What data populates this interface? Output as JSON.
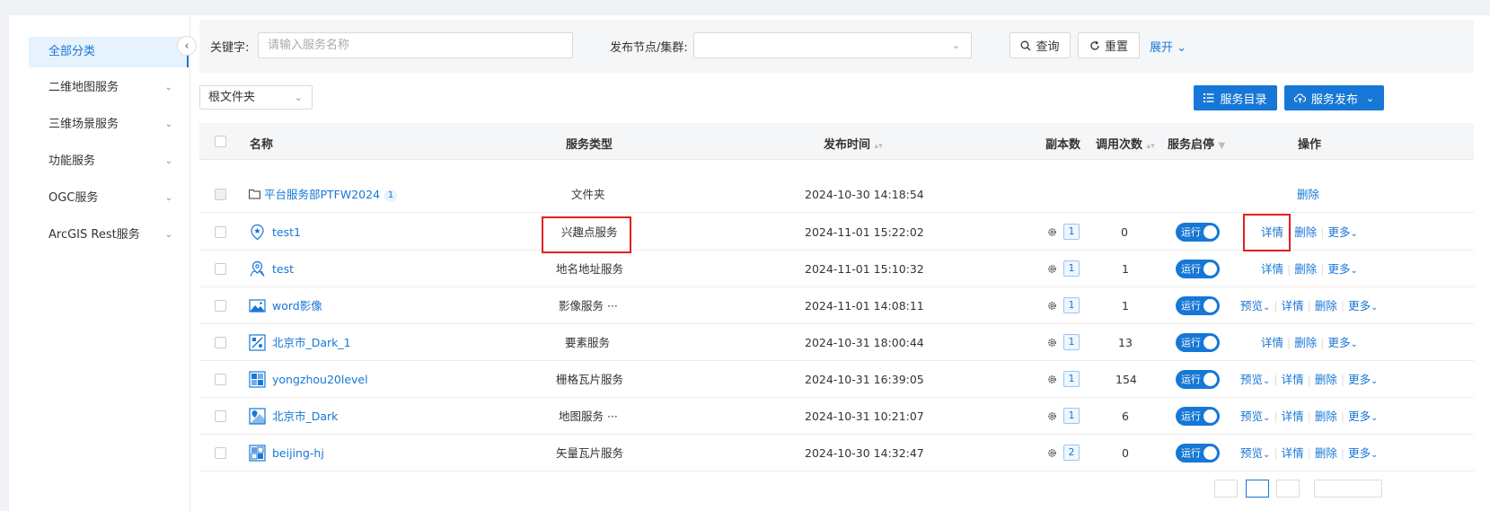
{
  "sidebar": {
    "collapse_icon": "chevron-left-icon",
    "items": [
      {
        "label": "全部分类",
        "active": true
      },
      {
        "label": "二维地图服务"
      },
      {
        "label": "三维场景服务"
      },
      {
        "label": "功能服务"
      },
      {
        "label": "OGC服务"
      },
      {
        "label": "ArcGIS Rest服务"
      }
    ]
  },
  "search": {
    "keyword_label": "关键字:",
    "keyword_placeholder": "请输入服务名称",
    "node_label": "发布节点/集群:",
    "node_value": "",
    "query_label": "查询",
    "reset_label": "重置",
    "expand_label": "展开"
  },
  "toolbar": {
    "folder_value": "根文件夹",
    "catalog_label": "服务目录",
    "publish_label": "服务发布"
  },
  "table": {
    "headers": {
      "name": "名称",
      "type": "服务类型",
      "time": "发布时间",
      "replicas": "副本数",
      "calls": "调用次数",
      "status": "服务启停",
      "ops": "操作"
    },
    "rows": [
      {
        "name": "平台服务部PTFW2024",
        "badge": "1",
        "icon": "folder-icon",
        "type": "文件夹",
        "time": "2024-10-30 14:18:54",
        "replicas": "",
        "calls": "",
        "status": "",
        "ops": [
          "删除"
        ]
      },
      {
        "name": "test1",
        "icon": "poi-pin-icon",
        "type": "兴趣点服务",
        "time": "2024-11-01 15:22:02",
        "replicas": "1",
        "calls": "0",
        "status": "运行",
        "ops": [
          "详情",
          "删除",
          "更多"
        ]
      },
      {
        "name": "test",
        "icon": "geocode-pin-icon",
        "type": "地名地址服务",
        "time": "2024-11-01 15:10:32",
        "replicas": "1",
        "calls": "1",
        "status": "运行",
        "ops": [
          "详情",
          "删除",
          "更多"
        ]
      },
      {
        "name": "word影像",
        "icon": "image-service-icon",
        "type": "影像服务 ···",
        "time": "2024-11-01 14:08:11",
        "replicas": "1",
        "calls": "1",
        "status": "运行",
        "ops": [
          "预览",
          "详情",
          "删除",
          "更多"
        ]
      },
      {
        "name": "北京市_Dark_1",
        "icon": "feature-service-icon",
        "type": "要素服务",
        "time": "2024-10-31 18:00:44",
        "replicas": "1",
        "calls": "13",
        "status": "运行",
        "ops": [
          "详情",
          "删除",
          "更多"
        ]
      },
      {
        "name": "yongzhou20level",
        "icon": "raster-tile-icon",
        "type": "栅格瓦片服务",
        "time": "2024-10-31 16:39:05",
        "replicas": "1",
        "calls": "154",
        "status": "运行",
        "ops": [
          "预览",
          "详情",
          "删除",
          "更多"
        ]
      },
      {
        "name": "北京市_Dark",
        "icon": "map-service-icon",
        "type": "地图服务 ···",
        "time": "2024-10-31 10:21:07",
        "replicas": "1",
        "calls": "6",
        "status": "运行",
        "ops": [
          "预览",
          "详情",
          "删除",
          "更多"
        ]
      },
      {
        "name": "beijing-hj",
        "icon": "vector-tile-icon",
        "type": "矢量瓦片服务",
        "time": "2024-10-30 14:32:47",
        "replicas": "2",
        "calls": "0",
        "status": "运行",
        "ops": [
          "预览",
          "详情",
          "删除",
          "更多"
        ]
      }
    ]
  },
  "colors": {
    "accent": "#1677d6",
    "highlight": "#e02020"
  }
}
